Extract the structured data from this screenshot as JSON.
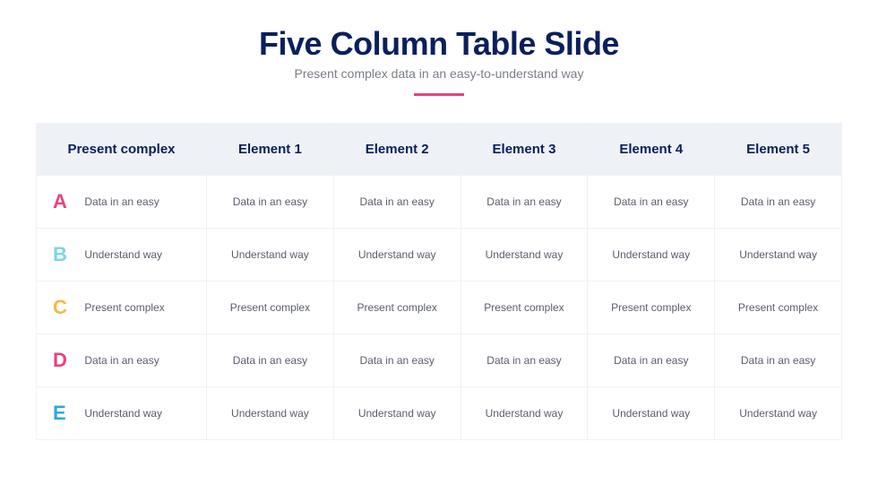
{
  "title": "Five Column Table Slide",
  "subtitle": "Present complex data in an easy-to-understand way",
  "headers": [
    "Present complex",
    "Element 1",
    "Element 2",
    "Element 3",
    "Element 4",
    "Element 5"
  ],
  "rows": [
    {
      "letter": "A",
      "color_class": "letter-a",
      "cells": [
        "Data in an easy",
        "Data in an easy",
        "Data in an easy",
        "Data in an easy",
        "Data in an easy",
        "Data in an easy"
      ]
    },
    {
      "letter": "B",
      "color_class": "letter-b",
      "cells": [
        "Understand way",
        "Understand way",
        "Understand way",
        "Understand way",
        "Understand way",
        "Understand way"
      ]
    },
    {
      "letter": "C",
      "color_class": "letter-c",
      "cells": [
        "Present complex",
        "Present complex",
        "Present complex",
        "Present complex",
        "Present complex",
        "Present complex"
      ]
    },
    {
      "letter": "D",
      "color_class": "letter-d",
      "cells": [
        "Data in an easy",
        "Data in an easy",
        "Data in an easy",
        "Data in an easy",
        "Data in an easy",
        "Data in an easy"
      ]
    },
    {
      "letter": "E",
      "color_class": "letter-e",
      "cells": [
        "Understand way",
        "Understand way",
        "Understand way",
        "Understand way",
        "Understand way",
        "Understand way"
      ]
    }
  ]
}
